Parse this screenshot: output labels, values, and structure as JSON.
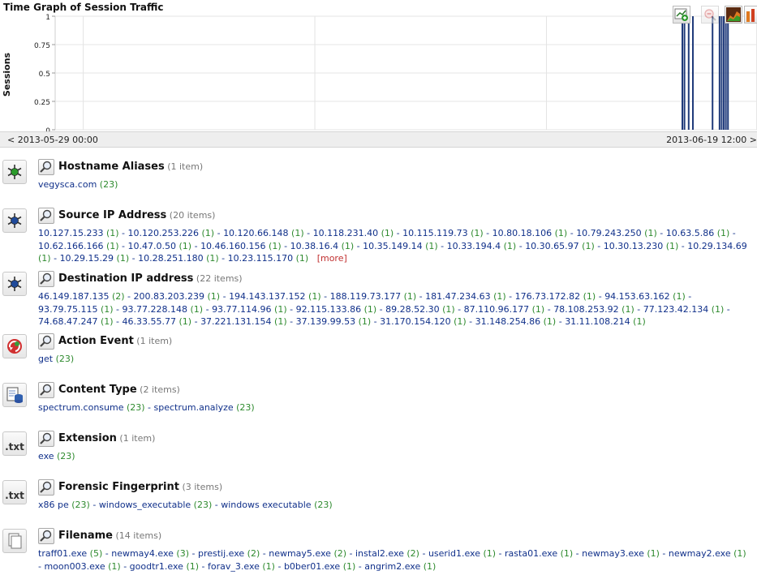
{
  "graph": {
    "title": "Time Graph of Session Traffic",
    "y_axis_label": "Sessions",
    "start_time": "< 2013-05-29 00:00",
    "end_time": "2013-06-19 12:00 >"
  },
  "chart_data": {
    "type": "bar",
    "ylabel": "Sessions",
    "ylim": [
      0,
      1
    ],
    "yticks": [
      "0",
      "0.25",
      "0.5",
      "0.75",
      "1"
    ],
    "grid": true,
    "x_start": "2013-05-29 00:00",
    "x_end": "2013-06-19 12:00",
    "x_window": [
      0,
      1
    ],
    "values": [
      [
        0.8925,
        1
      ],
      [
        0.8955,
        1
      ],
      [
        0.9015,
        1
      ],
      [
        0.9075,
        1
      ],
      [
        0.9355,
        1
      ],
      [
        0.9455,
        1
      ],
      [
        0.9485,
        1
      ],
      [
        0.9515,
        1
      ],
      [
        0.9545,
        1
      ],
      [
        0.9575,
        1
      ]
    ]
  },
  "facets": [
    {
      "title": "Hostname Aliases",
      "count_text": "(1 item)",
      "icon": "asterisk-green-icon",
      "items": [
        {
          "v": "vegysca.com",
          "c": "(23)"
        }
      ],
      "more": ""
    },
    {
      "title": "Source IP Address",
      "count_text": "(20 items)",
      "icon": "asterisk-blue-icon",
      "items": [
        {
          "v": "10.127.15.233",
          "c": "(1)"
        },
        {
          "v": "10.120.253.226",
          "c": "(1)"
        },
        {
          "v": "10.120.66.148",
          "c": "(1)"
        },
        {
          "v": "10.118.231.40",
          "c": "(1)"
        },
        {
          "v": "10.115.119.73",
          "c": "(1)"
        },
        {
          "v": "10.80.18.106",
          "c": "(1)"
        },
        {
          "v": "10.79.243.250",
          "c": "(1)"
        },
        {
          "v": "10.63.5.86",
          "c": "(1)"
        },
        {
          "v": "10.62.166.166",
          "c": "(1)"
        },
        {
          "v": "10.47.0.50",
          "c": "(1)"
        },
        {
          "v": "10.46.160.156",
          "c": "(1)"
        },
        {
          "v": "10.38.16.4",
          "c": "(1)"
        },
        {
          "v": "10.35.149.14",
          "c": "(1)"
        },
        {
          "v": "10.33.194.4",
          "c": "(1)"
        },
        {
          "v": "10.30.65.97",
          "c": "(1)"
        },
        {
          "v": "10.30.13.230",
          "c": "(1)"
        },
        {
          "v": "10.29.134.69",
          "c": "(1)"
        },
        {
          "v": "10.29.15.29",
          "c": "(1)"
        },
        {
          "v": "10.28.251.180",
          "c": "(1)"
        },
        {
          "v": "10.23.115.170",
          "c": "(1)"
        }
      ],
      "more": "[more]"
    },
    {
      "title": "Destination IP address",
      "count_text": "(22 items)",
      "icon": "asterisk-blue-icon",
      "items": [
        {
          "v": "46.149.187.135",
          "c": "(2)"
        },
        {
          "v": "200.83.203.239",
          "c": "(1)"
        },
        {
          "v": "194.143.137.152",
          "c": "(1)"
        },
        {
          "v": "188.119.73.177",
          "c": "(1)"
        },
        {
          "v": "181.47.234.63",
          "c": "(1)"
        },
        {
          "v": "176.73.172.82",
          "c": "(1)"
        },
        {
          "v": "94.153.63.162",
          "c": "(1)"
        },
        {
          "v": "93.79.75.115",
          "c": "(1)"
        },
        {
          "v": "93.77.228.148",
          "c": "(1)"
        },
        {
          "v": "93.77.114.96",
          "c": "(1)"
        },
        {
          "v": "92.115.133.86",
          "c": "(1)"
        },
        {
          "v": "89.28.52.30",
          "c": "(1)"
        },
        {
          "v": "87.110.96.177",
          "c": "(1)"
        },
        {
          "v": "78.108.253.92",
          "c": "(1)"
        },
        {
          "v": "77.123.42.134",
          "c": "(1)"
        },
        {
          "v": "74.68.47.247",
          "c": "(1)"
        },
        {
          "v": "46.33.55.77",
          "c": "(1)"
        },
        {
          "v": "37.221.131.154",
          "c": "(1)"
        },
        {
          "v": "37.139.99.53",
          "c": "(1)"
        },
        {
          "v": "31.170.154.120",
          "c": "(1)"
        },
        {
          "v": "31.148.254.86",
          "c": "(1)"
        },
        {
          "v": "31.11.108.214",
          "c": "(1)"
        }
      ],
      "more": ""
    },
    {
      "title": "Action Event",
      "count_text": "(1 item)",
      "icon": "action-event-icon",
      "items": [
        {
          "v": "get",
          "c": "(23)"
        }
      ],
      "more": ""
    },
    {
      "title": "Content Type",
      "count_text": "(2 items)",
      "icon": "content-type-icon",
      "items": [
        {
          "v": "spectrum.consume",
          "c": "(23)"
        },
        {
          "v": "spectrum.analyze",
          "c": "(23)"
        }
      ],
      "more": ""
    },
    {
      "title": "Extension",
      "count_text": "(1 item)",
      "icon": "txt-file-icon",
      "icon_text": ".txt",
      "items": [
        {
          "v": "exe",
          "c": "(23)"
        }
      ],
      "more": ""
    },
    {
      "title": "Forensic Fingerprint",
      "count_text": "(3 items)",
      "icon": "txt-file-icon",
      "icon_text": ".txt",
      "items": [
        {
          "v": "x86 pe",
          "c": "(23)"
        },
        {
          "v": "windows_executable",
          "c": "(23)"
        },
        {
          "v": "windows executable",
          "c": "(23)"
        }
      ],
      "more": ""
    },
    {
      "title": "Filename",
      "count_text": "(14 items)",
      "icon": "files-icon",
      "items": [
        {
          "v": "traff01.exe",
          "c": "(5)"
        },
        {
          "v": "newmay4.exe",
          "c": "(3)"
        },
        {
          "v": "prestij.exe",
          "c": "(2)"
        },
        {
          "v": "newmay5.exe",
          "c": "(2)"
        },
        {
          "v": "instal2.exe",
          "c": "(2)"
        },
        {
          "v": "userid1.exe",
          "c": "(1)"
        },
        {
          "v": "rasta01.exe",
          "c": "(1)"
        },
        {
          "v": "newmay3.exe",
          "c": "(1)"
        },
        {
          "v": "newmay2.exe",
          "c": "(1)"
        },
        {
          "v": "moon003.exe",
          "c": "(1)"
        },
        {
          "v": "goodtr1.exe",
          "c": "(1)"
        },
        {
          "v": "forav_3.exe",
          "c": "(1)"
        },
        {
          "v": "b0ber01.exe",
          "c": "(1)"
        },
        {
          "v": "angrim2.exe",
          "c": "(1)"
        }
      ],
      "more": ""
    }
  ],
  "colors": {
    "bar": "#1f3a7a",
    "value": "#10308a",
    "count": "#2e8a2e",
    "more": "#c03030"
  }
}
